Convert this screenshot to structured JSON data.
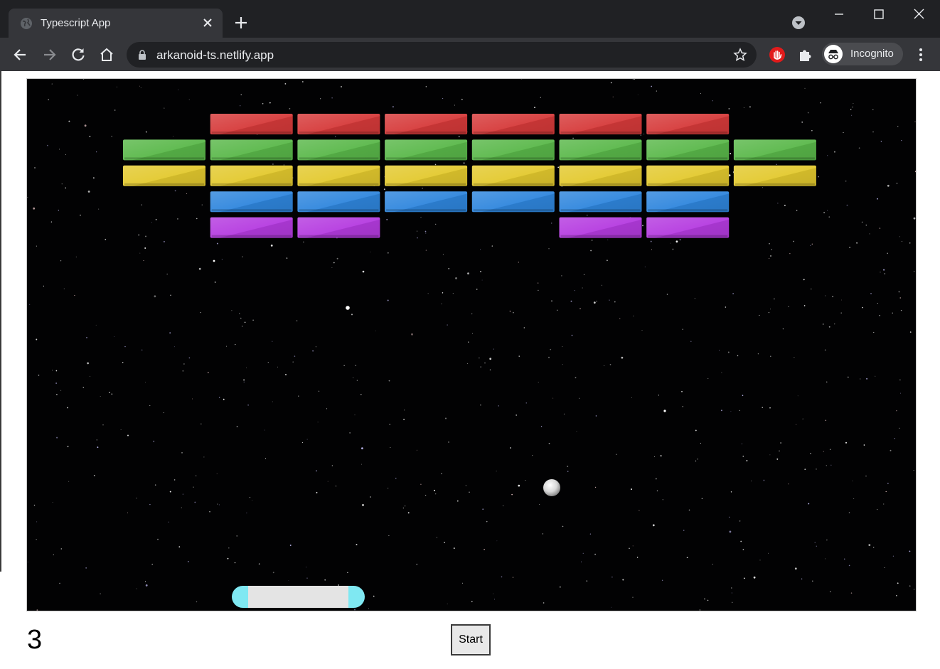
{
  "browser": {
    "tab": {
      "title": "Typescript App",
      "close_icon": "close-icon",
      "favicon": "globe-icon"
    },
    "new_tab_icon": "plus-icon",
    "tab_search_icon": "chevron-down-icon",
    "window_controls": [
      "minimize-icon",
      "maximize-icon",
      "close-icon"
    ],
    "nav": {
      "back": "arrow-left-icon",
      "forward": "arrow-right-icon",
      "reload": "reload-icon",
      "home": "home-icon"
    },
    "address": {
      "url": "arkanoid-ts.netlify.app",
      "lock_icon": "lock-icon",
      "bookmark_icon": "star-icon"
    },
    "extensions": [
      "hand-stop-icon",
      "puzzle-icon"
    ],
    "profile": {
      "label": "Incognito",
      "icon": "incognito-icon"
    },
    "menu_icon": "more-vertical-icon",
    "colors": {
      "frame": "#202124",
      "toolbar": "#35363a",
      "text": "#e8eaed"
    }
  },
  "game": {
    "lives": "3",
    "start_label": "Start",
    "brick_colors": {
      "red": "#d63a3a",
      "green": "#5ab84a",
      "yellow": "#e3c92e",
      "blue": "#2f86dd",
      "purple": "#b53be0"
    },
    "brick_rows": [
      {
        "color": "red",
        "columns": [
          2,
          3,
          4,
          5,
          6,
          7
        ]
      },
      {
        "color": "green",
        "columns": [
          1,
          2,
          3,
          4,
          5,
          6,
          7,
          8
        ]
      },
      {
        "color": "yellow",
        "columns": [
          1,
          2,
          3,
          4,
          5,
          6,
          7,
          8
        ]
      },
      {
        "color": "blue",
        "columns": [
          2,
          3,
          4,
          5,
          6,
          7
        ]
      },
      {
        "color": "purple",
        "columns": [
          2,
          3,
          6,
          7
        ]
      }
    ],
    "background": "starfield",
    "ball_color": "#e6e6e6",
    "paddle_colors": {
      "body": "#e4e4e4",
      "caps": "#7fe8f2"
    }
  }
}
